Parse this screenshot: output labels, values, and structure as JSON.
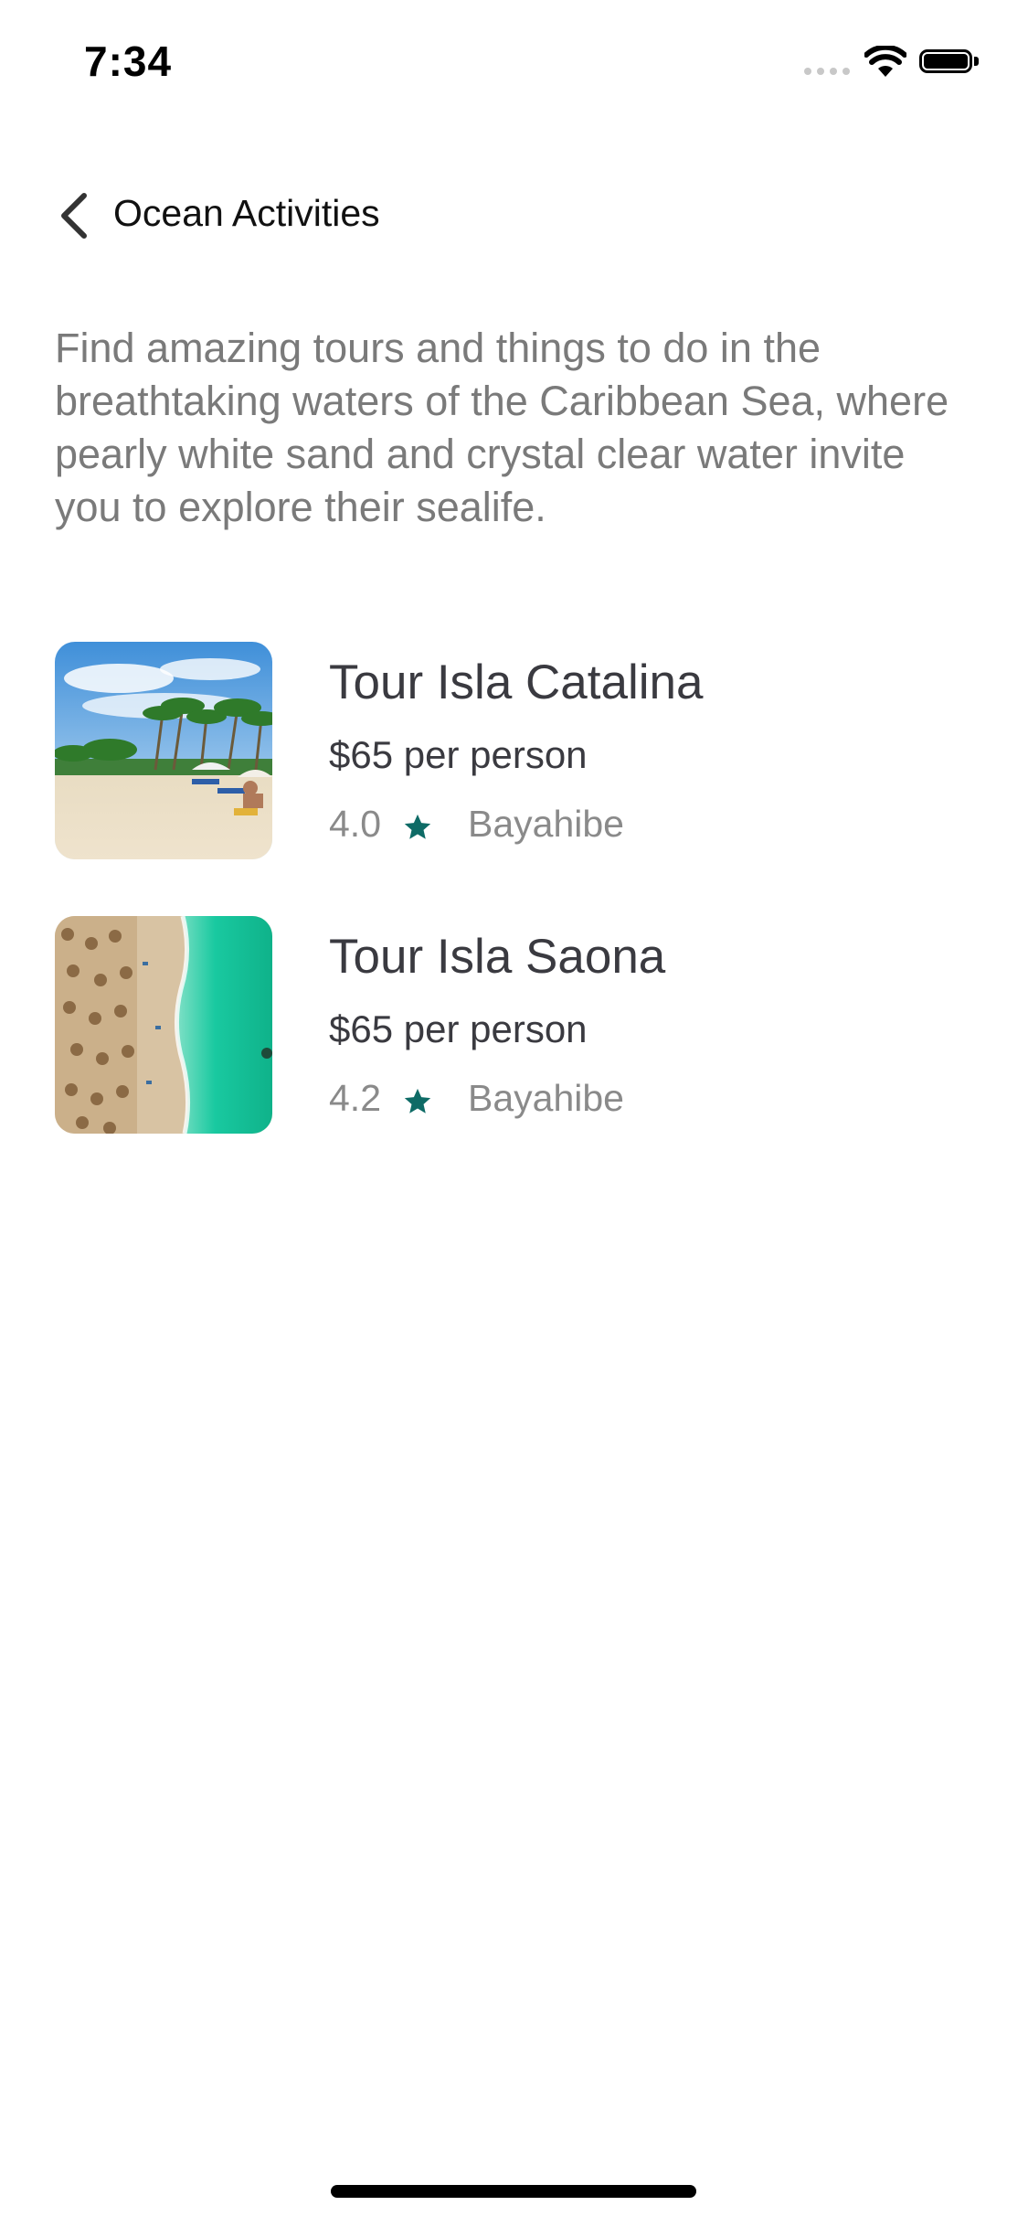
{
  "status_bar": {
    "time": "7:34",
    "icons": [
      "cellular-signal-icon",
      "wifi-icon",
      "battery-icon"
    ]
  },
  "nav": {
    "back_icon": "chevron-left-icon",
    "title": "Ocean Activities"
  },
  "intro": {
    "text": "Find amazing tours and things to do in the breathtaking waters of the Caribbean Sea, where pearly white sand and crystal clear water invite you to explore their sealife."
  },
  "tours": [
    {
      "name": "Tour Isla Catalina",
      "price": "$65 per person",
      "rating": "4.0",
      "location": "Bayahibe",
      "image": "beach-palms-photo"
    },
    {
      "name": "Tour Isla Saona",
      "price": "$65 per person",
      "rating": "4.2",
      "location": "Bayahibe",
      "image": "aerial-beach-photo"
    }
  ],
  "colors": {
    "accent_star": "#0e6b66",
    "text_primary": "#3a3a40",
    "text_secondary": "#7a7a7a"
  }
}
